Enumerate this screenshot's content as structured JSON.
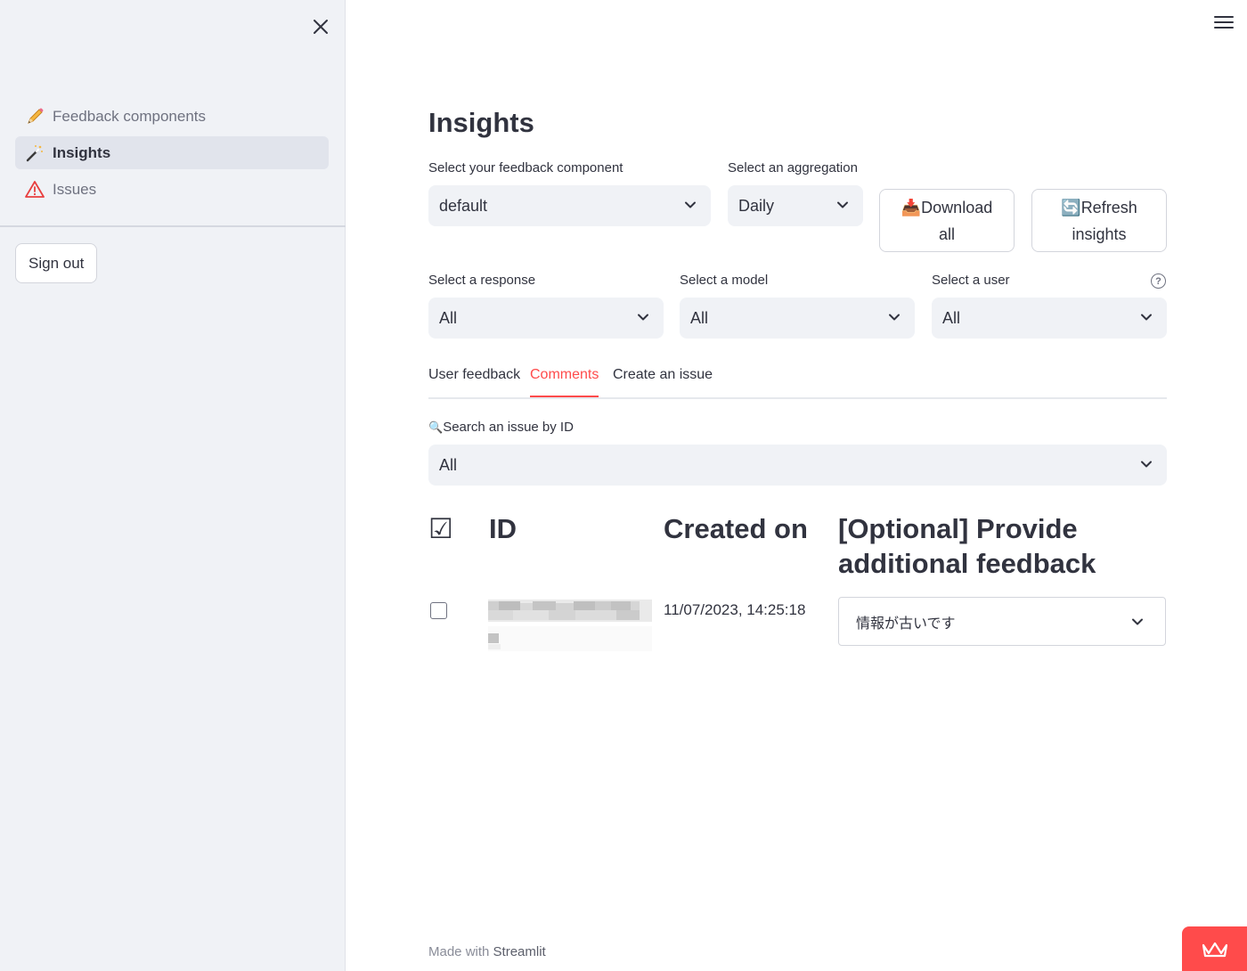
{
  "sidebar": {
    "items": [
      {
        "label": "Feedback components",
        "icon": "pencil-icon"
      },
      {
        "label": "Insights",
        "icon": "magic-wand-icon",
        "active": true
      },
      {
        "label": "Issues",
        "icon": "warning-icon"
      }
    ],
    "sign_out_label": "Sign out"
  },
  "main": {
    "title": "Insights",
    "feedback_component": {
      "label": "Select your feedback component",
      "value": "default"
    },
    "aggregation": {
      "label": "Select an aggregation",
      "value": "Daily"
    },
    "download_button": {
      "icon": "📥",
      "line1": "Download",
      "line2": "all"
    },
    "refresh_button": {
      "icon": "🔄",
      "line1": "Refresh",
      "line2": "insights"
    },
    "response": {
      "label": "Select a response",
      "value": "All"
    },
    "model": {
      "label": "Select a model",
      "value": "All"
    },
    "user": {
      "label": "Select a user",
      "value": "All",
      "help": "?"
    },
    "tabs": [
      {
        "label": "User feedback"
      },
      {
        "label": "Comments",
        "active": true
      },
      {
        "label": "Create an issue"
      }
    ],
    "search": {
      "icon": "🔍",
      "label": "Search an issue by ID",
      "value": "All"
    },
    "table": {
      "headers": {
        "check": "☑",
        "id": "ID",
        "created": "Created on",
        "feedback_line1": "[Optional] Provide",
        "feedback_line2": "additional feedback"
      },
      "rows": [
        {
          "created_on": "11/07/2023, 14:25:18",
          "feedback": "情報が古いです"
        }
      ]
    }
  },
  "footer": {
    "prefix": "Made with",
    "brand": "Streamlit"
  },
  "colors": {
    "accent": "#ff4b4b",
    "sidebar_bg": "#f0f2f6",
    "text": "#31333f"
  }
}
